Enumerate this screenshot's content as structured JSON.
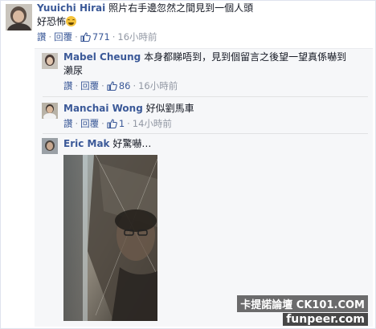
{
  "comments": [
    {
      "author": "Yuuichi Hirai",
      "text_line1": "照片右手邊忽然之間見到一個人頭",
      "text_line2": "好恐怖",
      "emoji": "grin-emoji",
      "actions": {
        "like": "讚",
        "reply": "回覆"
      },
      "likes": "771",
      "time": "16小時前"
    },
    {
      "author": "Mabel Cheung",
      "text_line1": "本身都睇唔到，見到個留言之後望一望真係嚇到",
      "text_line2": "瀨尿",
      "actions": {
        "like": "讚",
        "reply": "回覆"
      },
      "likes": "86",
      "time": "16小時前"
    },
    {
      "author": "Manchai Wong",
      "text_line1": "好似劉馬車",
      "actions": {
        "like": "讚",
        "reply": "回覆"
      },
      "likes": "1",
      "time": "14小時前"
    },
    {
      "author": "Eric Mak",
      "text_line1": "好驚嚇…",
      "photo": "attached-photo"
    }
  ],
  "watermark": {
    "line1": "卡提諾論壇 CK101.COM",
    "line2": "funpeer.com"
  },
  "colors": {
    "link": "#3b5998",
    "meta": "#9197a3",
    "text": "#141823",
    "reply_bg": "#f6f7f9"
  }
}
